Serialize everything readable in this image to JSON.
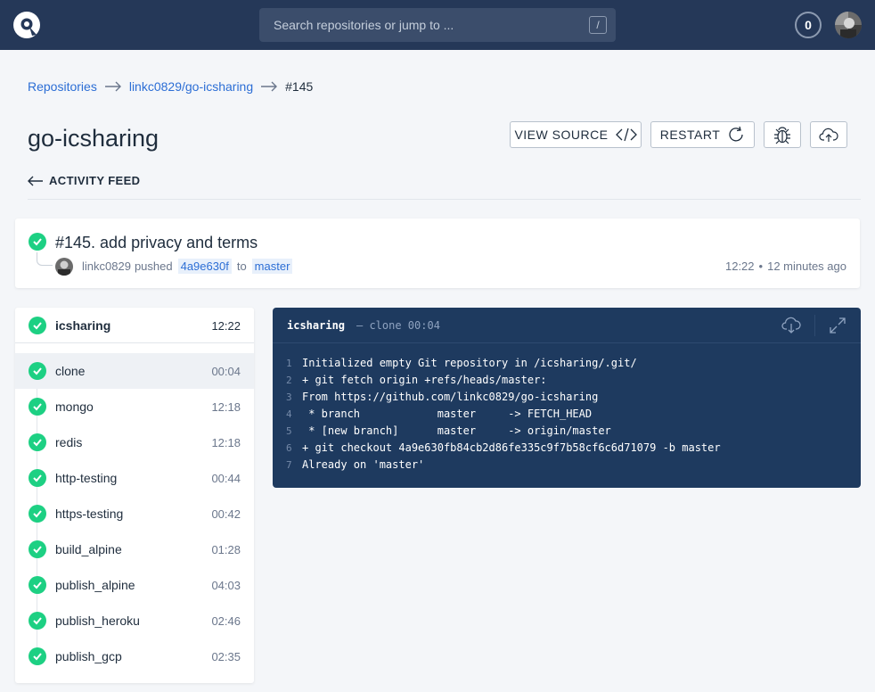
{
  "topbar": {
    "search_placeholder": "Search repositories or jump to ...",
    "search_shortcut": "/",
    "notification_count": "0"
  },
  "breadcrumb": {
    "items": [
      "Repositories",
      "linkc0829/go-icsharing"
    ],
    "current": "#145"
  },
  "repo": {
    "title": "go-icsharing"
  },
  "actions": {
    "view_source": "VIEW SOURCE",
    "restart": "RESTART"
  },
  "back_link": "ACTIVITY FEED",
  "build": {
    "title": "#145. add privacy and terms",
    "author": "linkc0829",
    "action": "pushed",
    "commit": "4a9e630f",
    "to_word": "to",
    "branch": "master",
    "time": "12:22",
    "ago": "12 minutes ago",
    "status_color": "#1dd083"
  },
  "stage": {
    "name": "icsharing",
    "time": "12:22"
  },
  "steps": [
    {
      "name": "clone",
      "time": "00:04"
    },
    {
      "name": "mongo",
      "time": "12:18"
    },
    {
      "name": "redis",
      "time": "12:18"
    },
    {
      "name": "http-testing",
      "time": "00:44"
    },
    {
      "name": "https-testing",
      "time": "00:42"
    },
    {
      "name": "build_alpine",
      "time": "01:28"
    },
    {
      "name": "publish_alpine",
      "time": "04:03"
    },
    {
      "name": "publish_heroku",
      "time": "02:46"
    },
    {
      "name": "publish_gcp",
      "time": "02:35"
    }
  ],
  "log": {
    "stage": "icsharing",
    "sub": "— clone  00:04",
    "lines": [
      {
        "n": "1",
        "text": "Initialized empty Git repository in /icsharing/.git/"
      },
      {
        "n": "2",
        "text": "+ git fetch origin +refs/heads/master:"
      },
      {
        "n": "3",
        "text": "From https://github.com/linkc0829/go-icsharing"
      },
      {
        "n": "4",
        "text": " * branch            master     -> FETCH_HEAD"
      },
      {
        "n": "5",
        "text": " * [new branch]      master     -> origin/master"
      },
      {
        "n": "6",
        "text": "+ git checkout 4a9e630fb84cb2d86fe335c9f7b58cf6c6d71079 -b master"
      },
      {
        "n": "7",
        "text": "Already on 'master'"
      }
    ]
  }
}
